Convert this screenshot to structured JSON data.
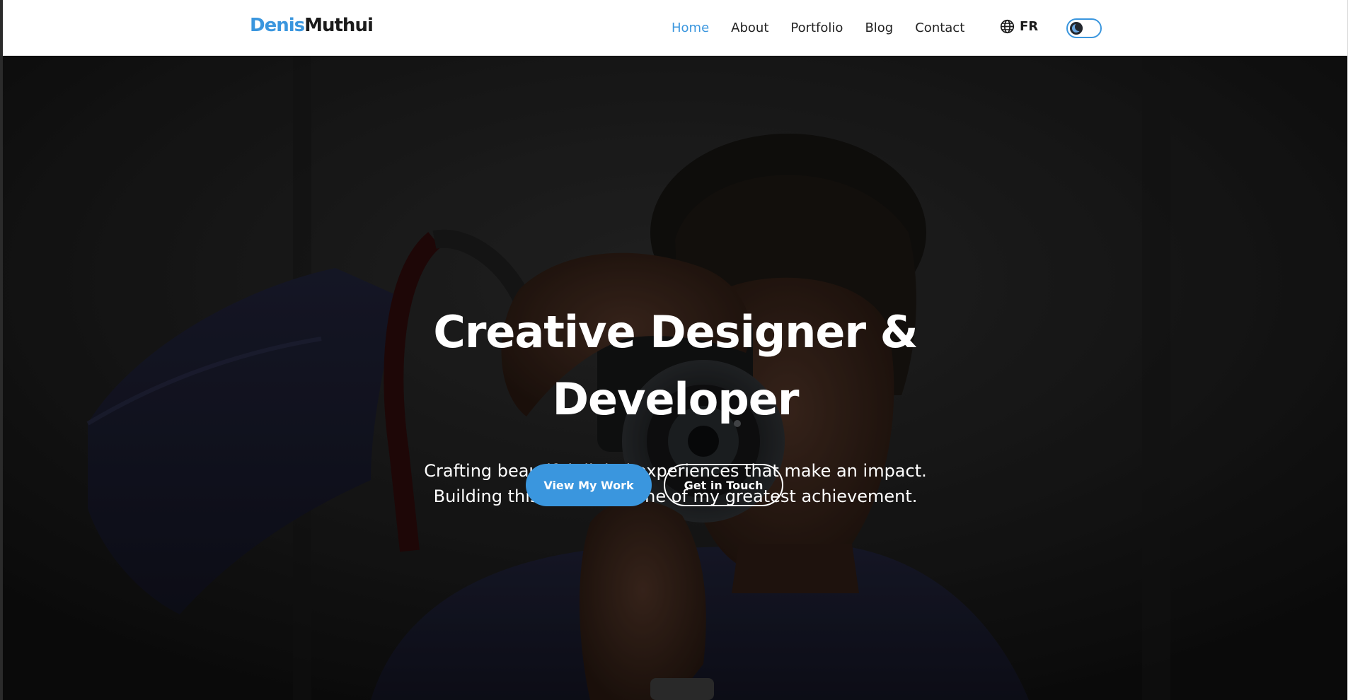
{
  "brand": {
    "first": "Denis",
    "last": "Muthui"
  },
  "nav": {
    "links": [
      {
        "label": "Home",
        "active": true
      },
      {
        "label": "About",
        "active": false
      },
      {
        "label": "Portfolio",
        "active": false
      },
      {
        "label": "Blog",
        "active": false
      },
      {
        "label": "Contact",
        "active": false
      }
    ],
    "language_label": "FR",
    "language_icon": "globe-icon",
    "theme_toggle_icon": "moon-icon"
  },
  "hero": {
    "title": "Creative Designer & Developer",
    "subtitle": "Crafting beautiful digital experiences that make an impact. Building this website is one of my greatest achievement.",
    "primary_button": "View My Work",
    "secondary_button": "Get in Touch",
    "background_image": "photographer-with-camera"
  },
  "colors": {
    "accent": "#3a96de",
    "text_dark": "#222222",
    "hero_text": "#ffffff"
  }
}
